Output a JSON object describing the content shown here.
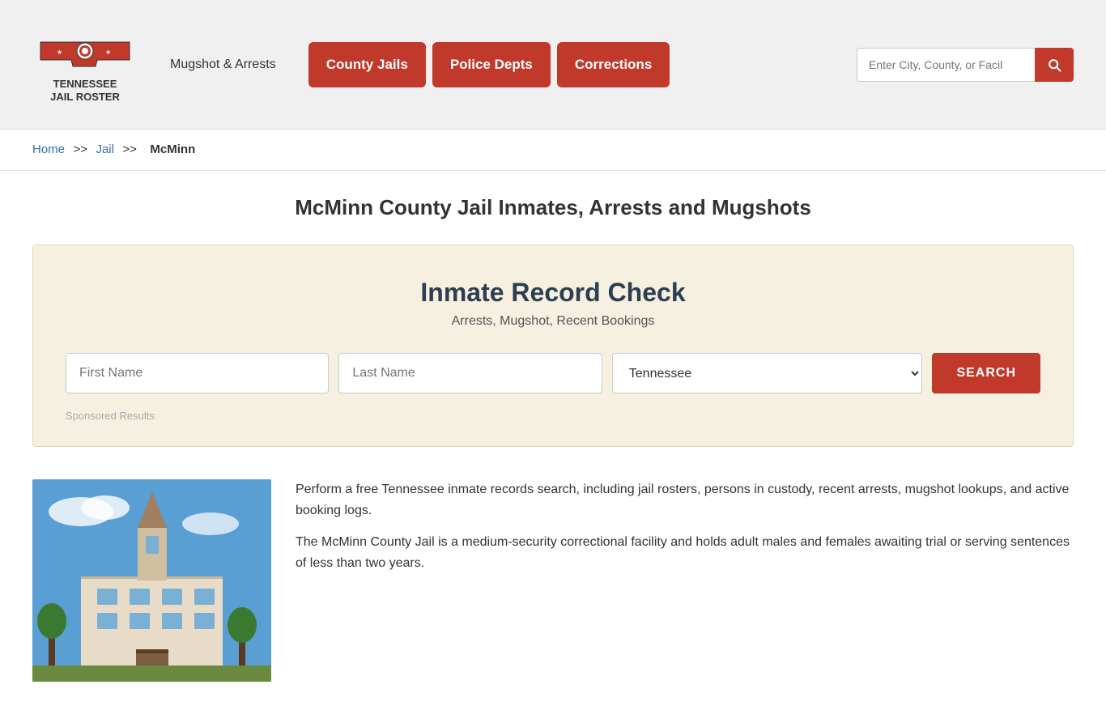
{
  "header": {
    "logo_line1": "TENNESSEE",
    "logo_line2": "JAIL ROSTER",
    "mugshot_link": "Mugshot & Arrests",
    "nav": {
      "county_jails": "County Jails",
      "police_depts": "Police Depts",
      "corrections": "Corrections"
    },
    "search_placeholder": "Enter City, County, or Facil"
  },
  "breadcrumb": {
    "home": "Home",
    "separator1": ">>",
    "jail": "Jail",
    "separator2": ">>",
    "current": "McMinn"
  },
  "page": {
    "title": "McMinn County Jail Inmates, Arrests and Mugshots"
  },
  "record_check": {
    "title": "Inmate Record Check",
    "subtitle": "Arrests, Mugshot, Recent Bookings",
    "first_name_placeholder": "First Name",
    "last_name_placeholder": "Last Name",
    "state_default": "Tennessee",
    "search_button": "SEARCH",
    "sponsored_label": "Sponsored Results"
  },
  "description": {
    "paragraph1": "Perform a free Tennessee inmate records search, including jail rosters, persons in custody, recent arrests, mugshot lookups, and active booking logs.",
    "paragraph2": "The McMinn County Jail is a medium-security correctional facility and holds adult males and females awaiting trial or serving sentences of less than two years."
  }
}
